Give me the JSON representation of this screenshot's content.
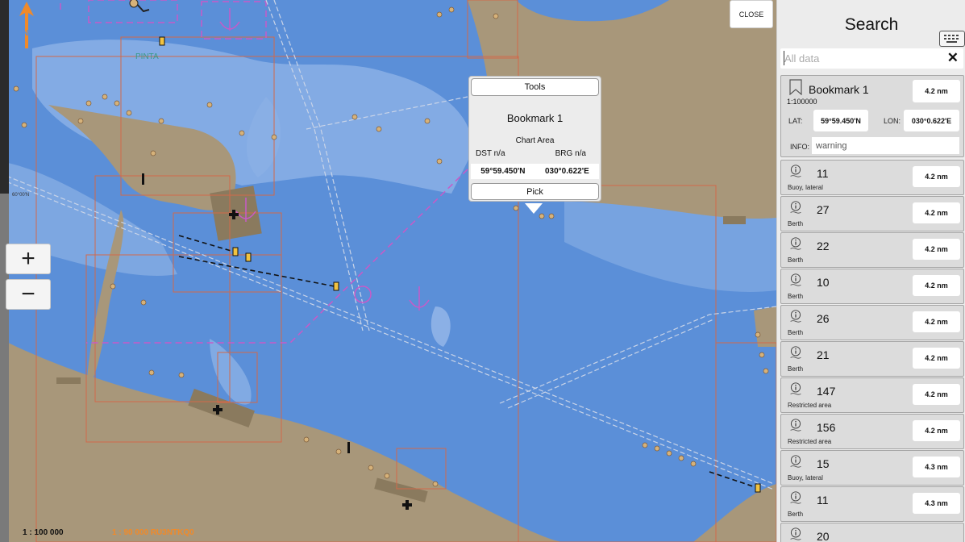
{
  "map": {
    "close_label": "CLOSE",
    "zoom_in": "+",
    "zoom_out": "−",
    "scale_left": "1 : 100 000",
    "scale_right": "1 : 90 000  RU3NTKQ0",
    "lat_label": "60°00'N",
    "chart_text": "PINTA"
  },
  "popup": {
    "tools_label": "Tools",
    "title": "Bookmark 1",
    "area": "Chart Area",
    "dst": "DST  n/a",
    "brg": "BRG  n/a",
    "lat": "59°59.450'N",
    "lon": "030°0.622'E",
    "pick_label": "Pick"
  },
  "panel": {
    "title": "Search",
    "search_placeholder": "All data",
    "clear": "✕",
    "bookmark": {
      "name": "Bookmark 1",
      "scale": "1:100000",
      "distance": "4.2 nm",
      "lat_label": "LAT:",
      "lat": "59°59.450'N",
      "lon_label": "LON:",
      "lon": "030°0.622'E",
      "info_label": "INFO:",
      "info": "warning"
    },
    "results": [
      {
        "num": "11",
        "kind": "Buoy, lateral",
        "distance": "4.2 nm"
      },
      {
        "num": "27",
        "kind": "Berth",
        "distance": "4.2 nm"
      },
      {
        "num": "22",
        "kind": "Berth",
        "distance": "4.2 nm"
      },
      {
        "num": "10",
        "kind": "Berth",
        "distance": "4.2 nm"
      },
      {
        "num": "26",
        "kind": "Berth",
        "distance": "4.2 nm"
      },
      {
        "num": "21",
        "kind": "Berth",
        "distance": "4.2 nm"
      },
      {
        "num": "147",
        "kind": "Restricted area",
        "distance": "4.2 nm"
      },
      {
        "num": "156",
        "kind": "Restricted area",
        "distance": "4.2 nm"
      },
      {
        "num": "15",
        "kind": "Buoy, lateral",
        "distance": "4.3 nm"
      },
      {
        "num": "11",
        "kind": "Berth",
        "distance": "4.3 nm"
      },
      {
        "num": "20",
        "kind": "",
        "distance": ""
      }
    ]
  },
  "colors": {
    "deep_water": "#5b8fd8",
    "shallow_water": "#8bb0e6",
    "land": "#a8977a",
    "chart_border": "#d2694a",
    "restricted": "#c85ac8",
    "scale_orange": "#f08a2a"
  }
}
